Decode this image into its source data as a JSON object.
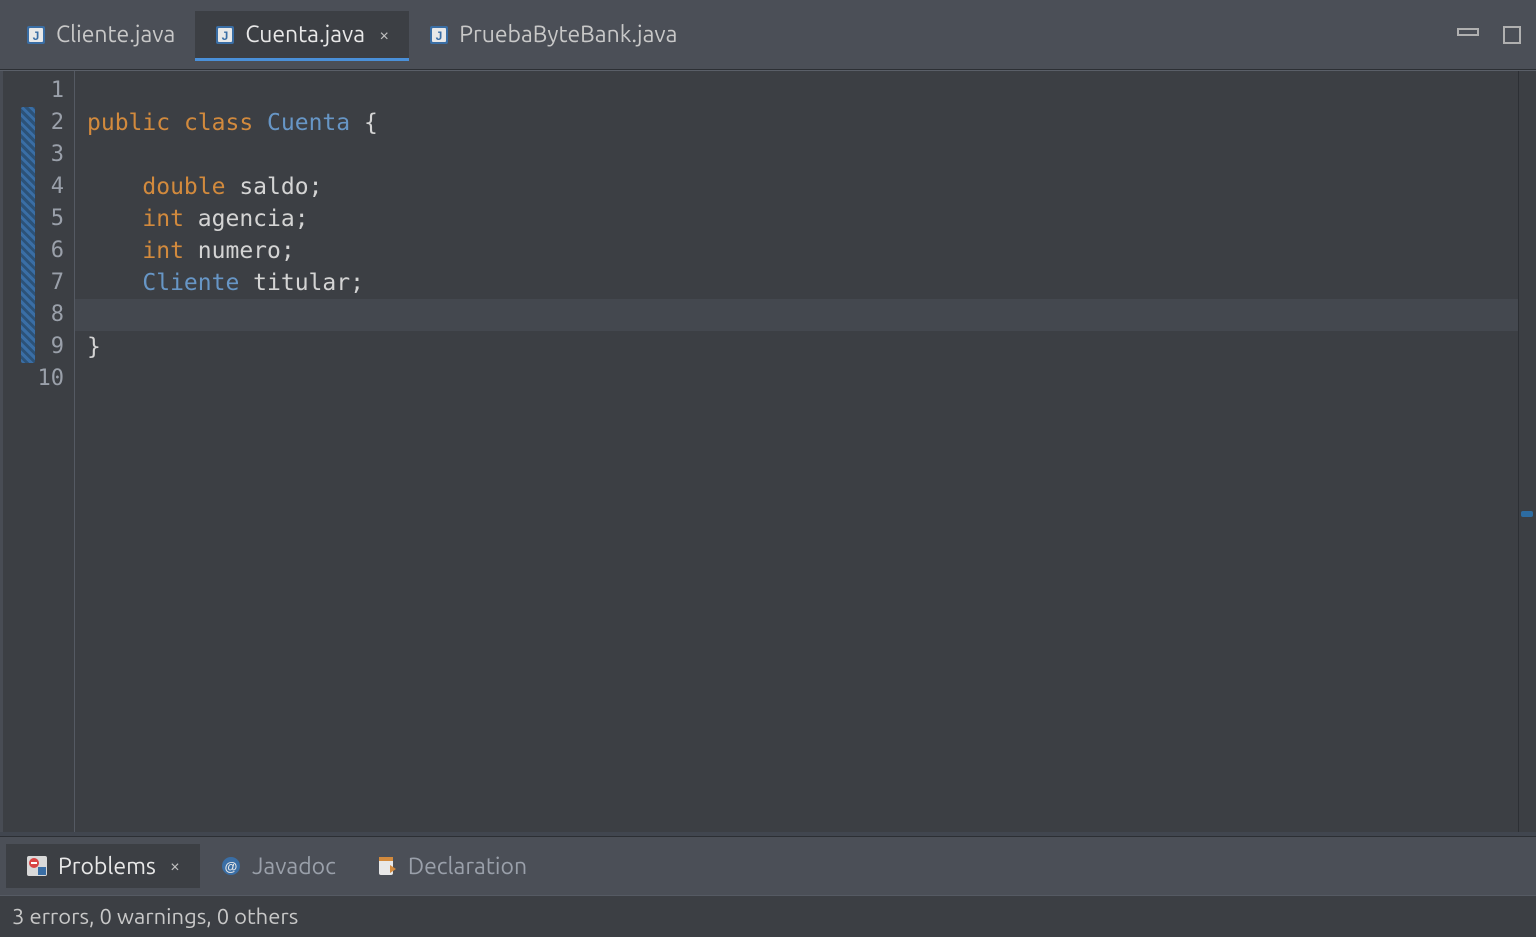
{
  "tabs": [
    {
      "label": "Cliente.java",
      "active": false,
      "closeable": false
    },
    {
      "label": "Cuenta.java",
      "active": true,
      "closeable": true
    },
    {
      "label": "PruebaByteBank.java",
      "active": false,
      "closeable": false
    }
  ],
  "editor": {
    "line_numbers": [
      "1",
      "2",
      "3",
      "4",
      "5",
      "6",
      "7",
      "8",
      "9",
      "10"
    ],
    "current_line_index": 7,
    "marker_lines_range": [
      1,
      8
    ],
    "lines": [
      {
        "tokens": []
      },
      {
        "tokens": [
          {
            "t": "public ",
            "c": "kw"
          },
          {
            "t": "class ",
            "c": "kw"
          },
          {
            "t": "Cuenta ",
            "c": "type"
          },
          {
            "t": "{",
            "c": "punct"
          }
        ]
      },
      {
        "tokens": []
      },
      {
        "tokens": [
          {
            "t": "    ",
            "c": "ident"
          },
          {
            "t": "double ",
            "c": "kw"
          },
          {
            "t": "saldo",
            "c": "ident"
          },
          {
            "t": ";",
            "c": "punct"
          }
        ]
      },
      {
        "tokens": [
          {
            "t": "    ",
            "c": "ident"
          },
          {
            "t": "int ",
            "c": "kw"
          },
          {
            "t": "agencia",
            "c": "ident"
          },
          {
            "t": ";",
            "c": "punct"
          }
        ]
      },
      {
        "tokens": [
          {
            "t": "    ",
            "c": "ident"
          },
          {
            "t": "int ",
            "c": "kw"
          },
          {
            "t": "numero",
            "c": "ident"
          },
          {
            "t": ";",
            "c": "punct"
          }
        ]
      },
      {
        "tokens": [
          {
            "t": "    ",
            "c": "ident"
          },
          {
            "t": "Cliente ",
            "c": "type"
          },
          {
            "t": "titular",
            "c": "ident"
          },
          {
            "t": ";",
            "c": "punct"
          }
        ]
      },
      {
        "tokens": []
      },
      {
        "tokens": [
          {
            "t": "}",
            "c": "punct"
          }
        ]
      },
      {
        "tokens": []
      }
    ]
  },
  "bottom": {
    "tabs": [
      {
        "label": "Problems",
        "active": true,
        "closeable": true,
        "icon": "problems"
      },
      {
        "label": "Javadoc",
        "active": false,
        "closeable": false,
        "icon": "javadoc"
      },
      {
        "label": "Declaration",
        "active": false,
        "closeable": false,
        "icon": "declaration"
      }
    ],
    "status": "3 errors, 0 warnings, 0 others"
  },
  "icons": {
    "java_file": "J",
    "close": "×",
    "minimize": "min",
    "maximize": "max"
  }
}
